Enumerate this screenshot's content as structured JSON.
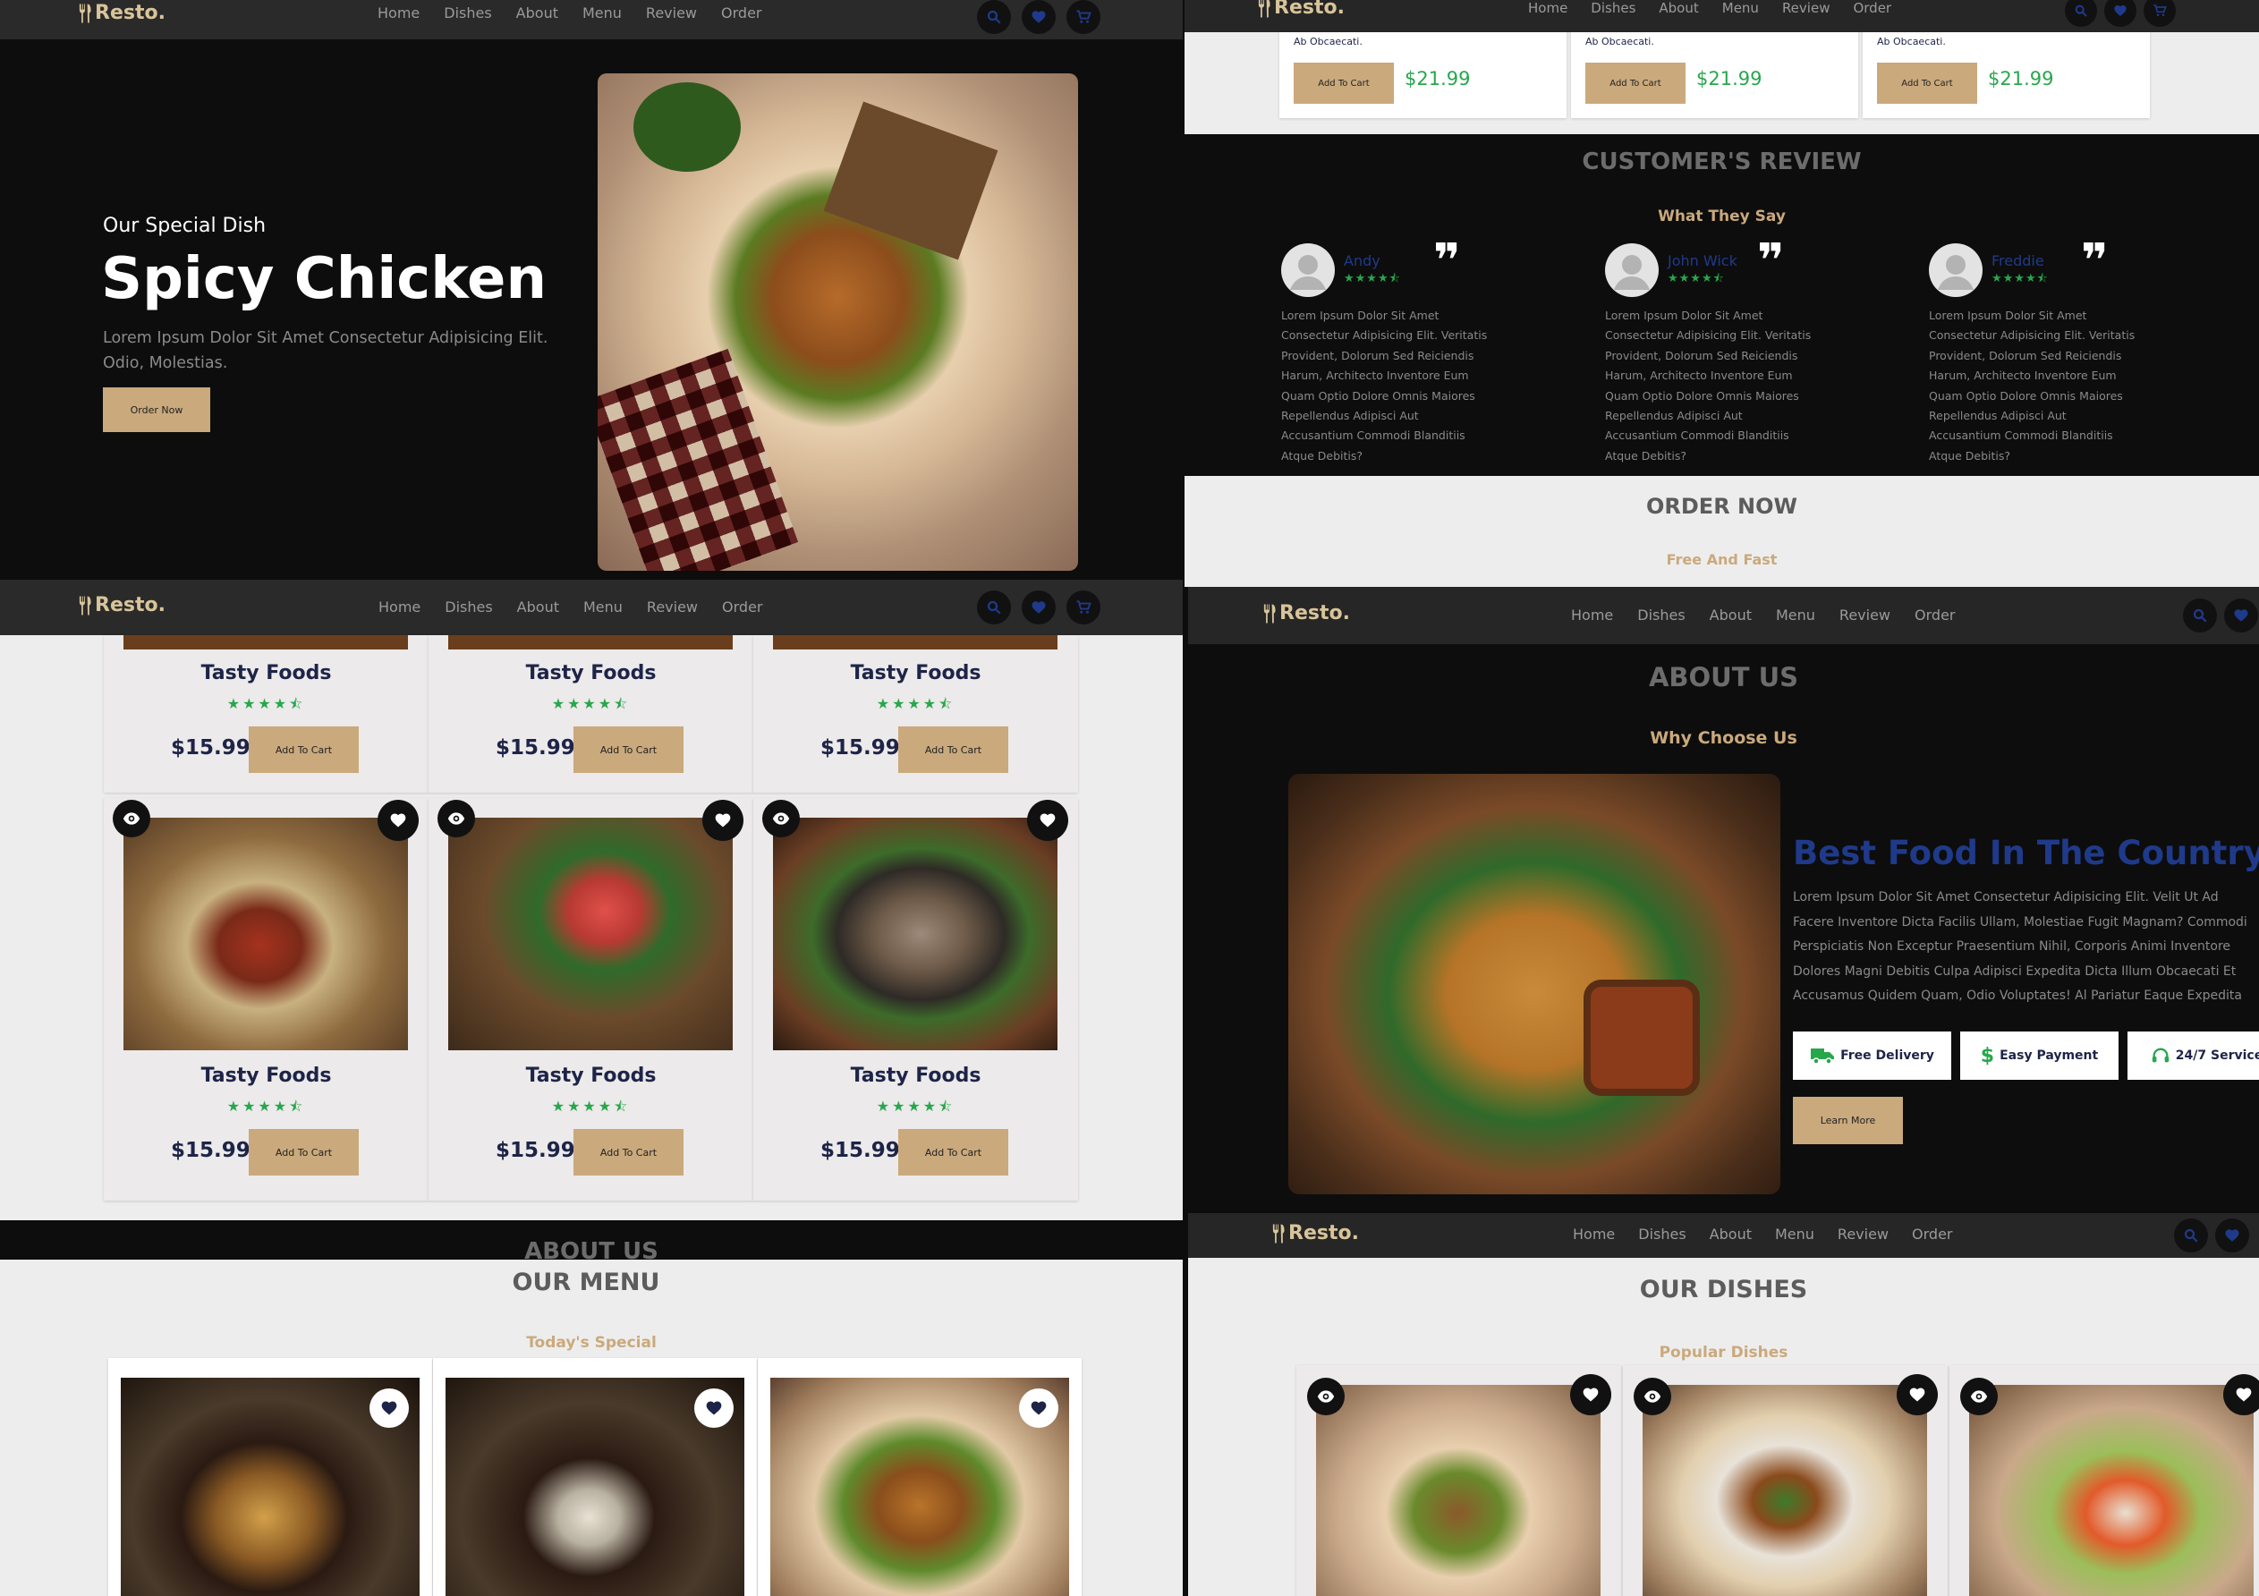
{
  "brand": "Resto.",
  "nav": [
    "Home",
    "Dishes",
    "About",
    "Menu",
    "Review",
    "Order"
  ],
  "hero": {
    "kicker": "Our Special Dish",
    "title": "Spicy Chicken",
    "text": "Lorem Ipsum Dolor Sit Amet Consectetur Adipisicing Elit. Odio, Molestias.",
    "button": "Order Now"
  },
  "menu_top": {
    "desc": "Ab Obcaecati.",
    "add_label": "Add To Cart",
    "price": "$21.99"
  },
  "review": {
    "title": "CUSTOMER'S REVIEW",
    "subtitle": "What They Say",
    "quote_glyph": "❞",
    "items": [
      {
        "name": "Andy",
        "text": "Lorem Ipsum Dolor Sit Amet Consectetur Adipisicing Elit. Veritatis Provident, Dolorum Sed Reiciendis Harum, Architecto Inventore Eum Quam Optio Dolore Omnis Maiores Repellendus Adipisci Aut Accusantium Commodi Blanditiis Atque Debitis?"
      },
      {
        "name": "John Wick",
        "text": "Lorem Ipsum Dolor Sit Amet Consectetur Adipisicing Elit. Veritatis Provident, Dolorum Sed Reiciendis Harum, Architecto Inventore Eum Quam Optio Dolore Omnis Maiores Repellendus Adipisci Aut Accusantium Commodi Blanditiis Atque Debitis?"
      },
      {
        "name": "Freddie",
        "text": "Lorem Ipsum Dolor Sit Amet Consectetur Adipisicing Elit. Veritatis Provident, Dolorum Sed Reiciendis Harum, Architecto Inventore Eum Quam Optio Dolore Omnis Maiores Repellendus Adipisci Aut Accusantium Commodi Blanditiis Atque Debitis?"
      }
    ]
  },
  "order": {
    "title": "ORDER NOW",
    "subtitle": "Free And Fast"
  },
  "dishes_grid": {
    "name": "Tasty Foods",
    "price": "$15.99",
    "add_label": "Add To Cart",
    "stars": "★★★★⯪",
    "peek_title": "ABOUT US"
  },
  "about": {
    "title": "ABOUT US",
    "subtitle": "Why Choose Us",
    "heading": "Best Food In The Country",
    "text": "Lorem Ipsum Dolor Sit Amet Consectetur Adipisicing Elit. Velit Ut Ad Facere Inventore Dicta Facilis Ullam, Molestiae Fugit Magnam? Commodi Perspiciatis Non Exceptur Praesentium Nihil, Corporis Animi Inventore Dolores Magni Debitis Culpa Adipisci Expedita Dicta Illum Obcaecati Et Accusamus Quidem Quam, Odio Voluptates! Al Pariatur Eaque Expedita Deserunt Quisquam Culpa.",
    "features": [
      "Free Delivery",
      "Easy Payment",
      "24/7 Service"
    ],
    "button": "Learn More"
  },
  "our_menu": {
    "title": "OUR MENU",
    "subtitle": "Today's Special"
  },
  "our_dishes": {
    "title": "OUR DISHES",
    "subtitle": "Popular Dishes"
  },
  "colors": {
    "accent": "#caa97c",
    "dark": "#0d0d0d",
    "navy": "#1e2448",
    "green": "#27a74c",
    "blue": "#1f3a8a"
  }
}
